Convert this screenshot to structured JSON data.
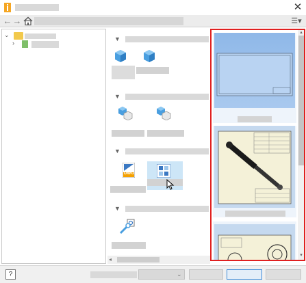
{
  "window": {
    "title": "",
    "close_glyph": "✕"
  },
  "toolbar": {
    "back_glyph": "←",
    "forward_glyph": "→",
    "home_icon": "home-icon",
    "path_text": "",
    "view_menu_glyph": "☰▾"
  },
  "tree": {
    "items": [
      {
        "label": "",
        "expanded": true,
        "arrow": "⌄"
      },
      {
        "label": "",
        "expanded": false,
        "arrow": "›"
      }
    ]
  },
  "template_sections": [
    {
      "label": "",
      "templates": [
        {
          "label": "",
          "icon": "part-cube-icon"
        },
        {
          "label": "",
          "icon": "part-cube-icon"
        }
      ]
    },
    {
      "label": "",
      "templates": [
        {
          "label": "",
          "icon": "assembly-icon"
        },
        {
          "label": "",
          "icon": "assembly-icon"
        }
      ]
    },
    {
      "label": "",
      "templates": [
        {
          "label": "",
          "icon": "dwg-drawing-icon",
          "badge": "DWG"
        },
        {
          "label": "",
          "icon": "idw-drawing-icon",
          "selected": true
        }
      ]
    },
    {
      "label": "",
      "templates": [
        {
          "label": "",
          "icon": "presentation-icon"
        }
      ]
    }
  ],
  "preview": {
    "items": [
      {
        "label": ""
      },
      {
        "label": ""
      },
      {
        "label": ""
      }
    ]
  },
  "footer": {
    "help_glyph": "?",
    "project_label": "",
    "project_value": "",
    "buttons": [
      "",
      "",
      ""
    ]
  },
  "colors": {
    "highlight_border": "#e02020",
    "selected_tile": "#cde6f7",
    "cube_blue": "#4a9fe0"
  }
}
